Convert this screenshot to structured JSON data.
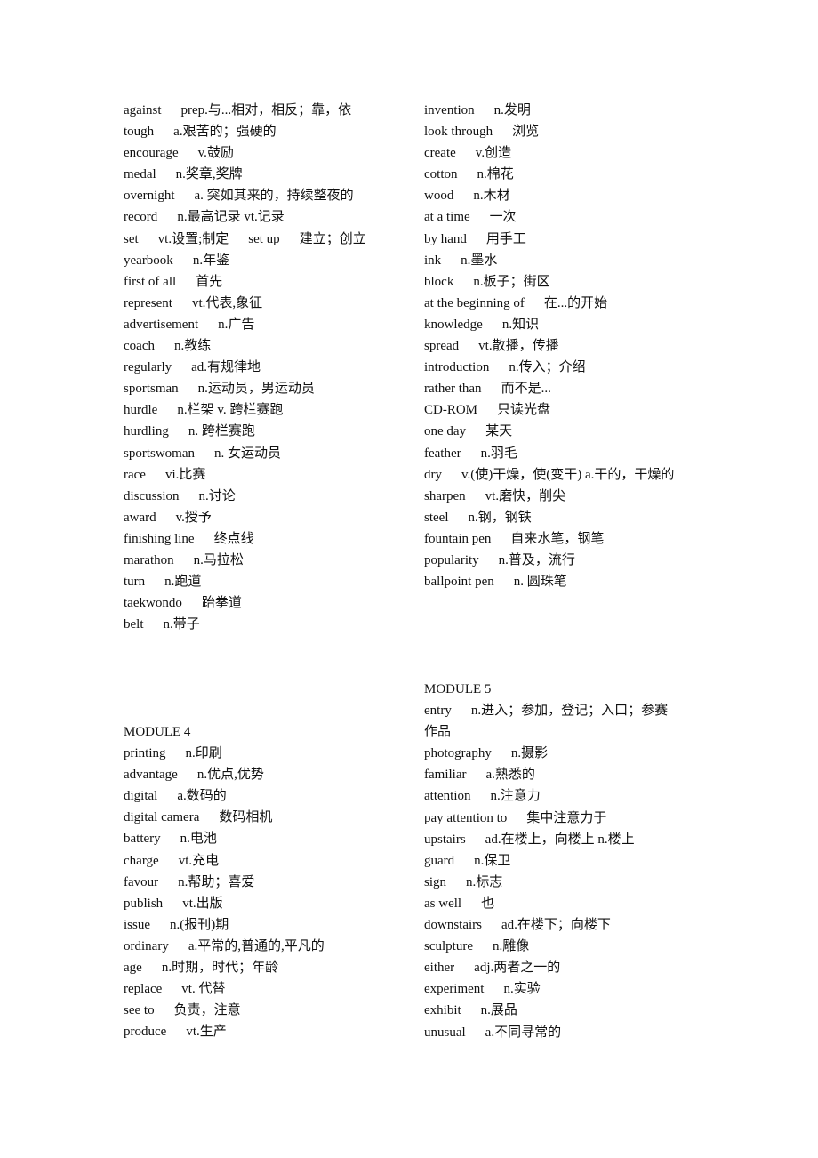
{
  "left_top": [
    {
      "term": "against",
      "def": "prep.与...相对，相反；靠，依"
    },
    {
      "term": "tough",
      "def": "a.艰苦的；强硬的"
    },
    {
      "term": "encourage",
      "def": "v.鼓励"
    },
    {
      "term": "medal",
      "def": "n.奖章,奖牌"
    },
    {
      "term": "overnight",
      "def": "a. 突如其来的，持续整夜的"
    },
    {
      "term": "record",
      "def": "n.最高记录 vt.记录"
    },
    {
      "term": "set",
      "def": "vt.设置;制定",
      "term2": "set up",
      "def2": "建立；创立"
    },
    {
      "term": "yearbook",
      "def": "n.年鉴"
    },
    {
      "term": "first of all",
      "def": "首先"
    },
    {
      "term": "represent",
      "def": "vt.代表,象征"
    },
    {
      "term": "advertisement",
      "def": "n.广告"
    },
    {
      "term": "coach",
      "def": "n.教练"
    },
    {
      "term": "regularly",
      "def": "ad.有规律地"
    },
    {
      "term": "sportsman",
      "def": "n.运动员，男运动员"
    },
    {
      "term": "hurdle",
      "def": "n.栏架  v. 跨栏赛跑"
    },
    {
      "term": "hurdling",
      "def": "n. 跨栏赛跑"
    },
    {
      "term": "sportswoman",
      "def": "n. 女运动员"
    },
    {
      "term": "race",
      "def": "vi.比赛"
    },
    {
      "term": "discussion",
      "def": "n.讨论"
    },
    {
      "term": "award",
      "def": "v.授予"
    },
    {
      "term": "finishing line",
      "def": "终点线"
    },
    {
      "term": "marathon",
      "def": "n.马拉松"
    },
    {
      "term": "turn",
      "def": "n.跑道"
    },
    {
      "term": "taekwondo",
      "def": "跆拳道"
    },
    {
      "term": "belt",
      "def": "n.带子"
    }
  ],
  "right_top": [
    {
      "term": "invention",
      "def": "n.发明"
    },
    {
      "term": "look through",
      "def": "浏览"
    },
    {
      "term": "create",
      "def": "v.创造"
    },
    {
      "term": "cotton",
      "def": "n.棉花"
    },
    {
      "term": "wood",
      "def": "n.木材"
    },
    {
      "term": "at a time",
      "def": "一次"
    },
    {
      "term": "by hand",
      "def": "用手工"
    },
    {
      "term": "ink",
      "def": "n.墨水"
    },
    {
      "term": "block",
      "def": "n.板子；街区"
    },
    {
      "term": "at the beginning of",
      "def": "在...的开始"
    },
    {
      "term": "knowledge",
      "def": "n.知识"
    },
    {
      "term": "spread",
      "def": "vt.散播，传播"
    },
    {
      "term": "introduction",
      "def": "n.传入；介绍"
    },
    {
      "term": "rather than",
      "def": "而不是..."
    },
    {
      "term": "CD-ROM",
      "def": "只读光盘"
    },
    {
      "term": "one day",
      "def": "某天"
    },
    {
      "term": "feather",
      "def": "n.羽毛"
    },
    {
      "term": "dry",
      "def": "v.(使)干燥，使(变干) a.干的，干燥的"
    },
    {
      "term": "sharpen",
      "def": "vt.磨快，削尖"
    },
    {
      "term": "steel",
      "def": "n.钢，钢铁"
    },
    {
      "term": "fountain pen",
      "def": "自来水笔，钢笔"
    },
    {
      "term": "popularity",
      "def": "n.普及，流行"
    },
    {
      "term": "ballpoint pen",
      "def": "n. 圆珠笔"
    }
  ],
  "module4": {
    "heading": "MODULE 4",
    "items": [
      {
        "term": "printing",
        "def": "n.印刷"
      },
      {
        "term": "advantage",
        "def": "n.优点,优势"
      },
      {
        "term": "digital",
        "def": "a.数码的"
      },
      {
        "term": "digital camera",
        "def": "数码相机"
      },
      {
        "term": "battery",
        "def": "n.电池"
      },
      {
        "term": "charge",
        "def": "vt.充电"
      },
      {
        "term": "favour",
        "def": "n.帮助；喜爱"
      },
      {
        "term": "publish",
        "def": "vt.出版"
      },
      {
        "term": "issue",
        "def": "n.(报刊)期"
      },
      {
        "term": "ordinary",
        "def": "a.平常的,普通的,平凡的"
      },
      {
        "term": "age",
        "def": "n.时期，时代；年龄"
      },
      {
        "term": "replace",
        "def": "vt. 代替"
      },
      {
        "term": "see to",
        "def": "负责，注意"
      },
      {
        "term": "produce",
        "def": "vt.生产"
      }
    ]
  },
  "module5": {
    "heading": "MODULE 5",
    "entry": {
      "term": "entry",
      "def": "n.进入；参加，登记；入口；参赛",
      "def_cont": "作品"
    },
    "items": [
      {
        "term": "photography",
        "def": "n.摄影"
      },
      {
        "term": "familiar",
        "def": "a.熟悉的"
      },
      {
        "term": "attention",
        "def": "n.注意力"
      },
      {
        "term": "pay attention to",
        "def": "集中注意力于"
      },
      {
        "term": "upstairs",
        "def": "ad.在楼上，向楼上  n.楼上"
      },
      {
        "term": "guard",
        "def": "n.保卫"
      },
      {
        "term": "sign",
        "def": "n.标志"
      },
      {
        "term": "as well",
        "def": "也"
      },
      {
        "term": "downstairs",
        "def": "ad.在楼下；向楼下"
      },
      {
        "term": "sculpture",
        "def": "n.雕像"
      },
      {
        "term": "either",
        "def": "adj.两者之一的"
      },
      {
        "term": "experiment",
        "def": "n.实验"
      },
      {
        "term": "exhibit",
        "def": "n.展品"
      },
      {
        "term": "unusual",
        "def": "a.不同寻常的"
      }
    ]
  }
}
